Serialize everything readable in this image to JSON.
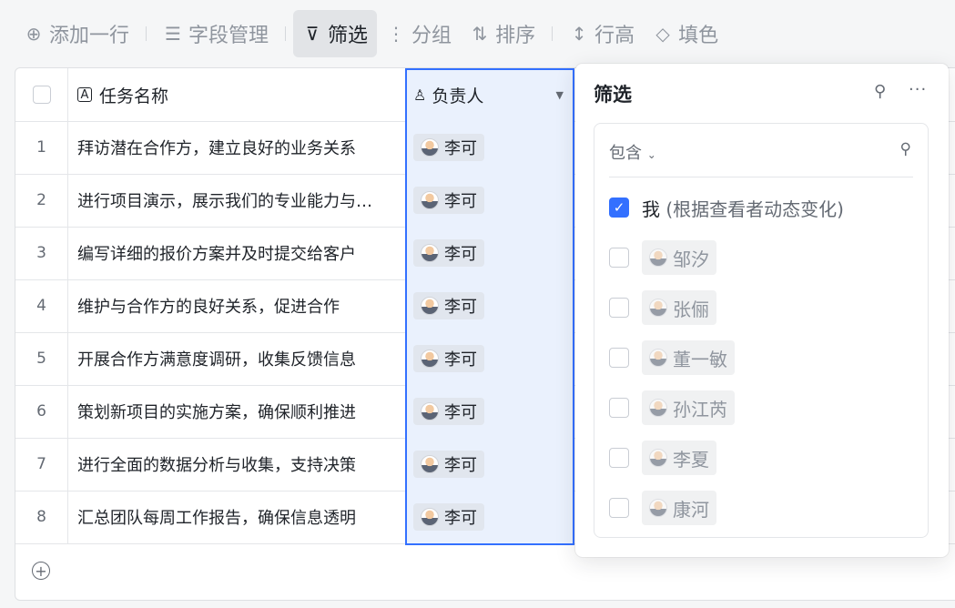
{
  "toolbar": {
    "add_row": "添加一行",
    "fields": "字段管理",
    "filter": "筛选",
    "group": "分组",
    "sort": "排序",
    "row_height": "行高",
    "fill": "填色"
  },
  "table": {
    "col_name": "任务名称",
    "col_owner": "负责人",
    "rows": [
      {
        "n": "1",
        "name": "拜访潜在合作方，建立良好的业务关系",
        "owner": "李可"
      },
      {
        "n": "2",
        "name": "进行项目演示，展示我们的专业能力与…",
        "owner": "李可"
      },
      {
        "n": "3",
        "name": "编写详细的报价方案并及时提交给客户",
        "owner": "李可"
      },
      {
        "n": "4",
        "name": "维护与合作方的良好关系，促进合作",
        "owner": "李可"
      },
      {
        "n": "5",
        "name": "开展合作方满意度调研，收集反馈信息",
        "owner": "李可"
      },
      {
        "n": "6",
        "name": "策划新项目的实施方案，确保顺利推进",
        "owner": "李可"
      },
      {
        "n": "7",
        "name": "进行全面的数据分析与收集，支持决策",
        "owner": "李可"
      },
      {
        "n": "8",
        "name": "汇总团队每周工作报告，确保信息透明",
        "owner": "李可"
      }
    ]
  },
  "filter_panel": {
    "title": "筛选",
    "operator": "包含",
    "me_label": "我",
    "me_hint": "(根据查看者动态变化)",
    "me_checked": true,
    "people": [
      "邹汐",
      "张俪",
      "董一敏",
      "孙江芮",
      "李夏",
      "康河"
    ]
  },
  "colors": {
    "accent": "#3370ff",
    "selected_column_bg": "#eaf1fd"
  }
}
